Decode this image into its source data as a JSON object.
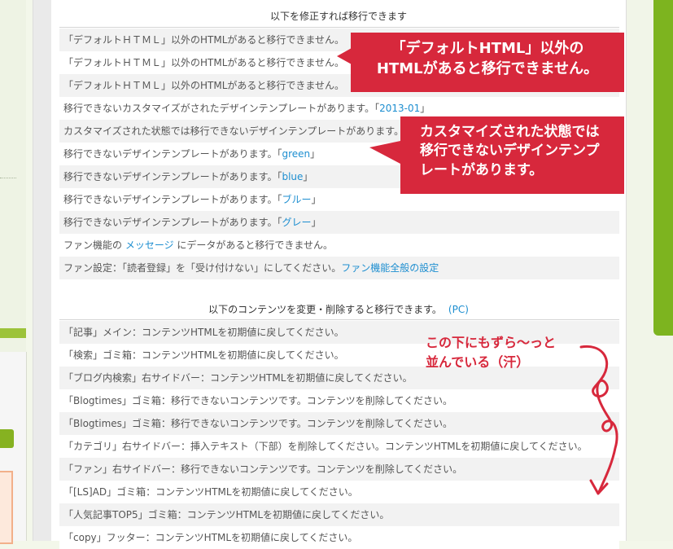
{
  "section1": {
    "title": "以下を修正すれば移行できます",
    "rows": [
      {
        "text": "「デフォルトＨＴＭＬ」以外のHTMLがあると移行できません。",
        "link": "",
        "suffix": ""
      },
      {
        "text": "「デフォルトＨＴＭＬ」以外のHTMLがあると移行できません。",
        "link": "",
        "suffix": ""
      },
      {
        "text": "「デフォルトＨＴＭＬ」以外のHTMLがあると移行できません。",
        "link": "",
        "suffix": ""
      },
      {
        "text": "移行できないカスタマイズがされたデザインテンプレートがあります。「",
        "link": "2013-01",
        "suffix": "」"
      },
      {
        "text": "カスタマイズされた状態では移行できないデザインテンプレートがあります。",
        "link": "",
        "suffix": ""
      },
      {
        "text": "移行できないデザインテンプレートがあります。「",
        "link": "green",
        "suffix": "」"
      },
      {
        "text": "移行できないデザインテンプレートがあります。「",
        "link": "blue",
        "suffix": "」"
      },
      {
        "text": "移行できないデザインテンプレートがあります。「",
        "link": "ブルー",
        "suffix": "」"
      },
      {
        "text": "移行できないデザインテンプレートがあります。「",
        "link": "グレー",
        "suffix": "」"
      },
      {
        "text": "ファン機能の ",
        "link": "メッセージ",
        "suffix": " にデータがあると移行できません。"
      },
      {
        "text": "ファン設定：「読者登録」を「受け付けない」にしてください。",
        "link": "ファン機能全般の設定",
        "suffix": ""
      }
    ]
  },
  "section2": {
    "title": "以下のコンテンツを変更・削除すると移行できます。",
    "pc_link": "(PC)",
    "rows": [
      "「記事」メイン：コンテンツHTMLを初期値に戻してください。",
      "「検索」ゴミ箱：コンテンツHTMLを初期値に戻してください。",
      "「ブログ内検索」右サイドバー：コンテンツHTMLを初期値に戻してください。",
      "「Blogtimes」ゴミ箱：移行できないコンテンツです。コンテンツを削除してください。",
      "「Blogtimes」ゴミ箱：移行できないコンテンツです。コンテンツを削除してください。",
      "「カテゴリ」右サイドバー：挿入テキスト（下部）を削除してください。コンテンツHTMLを初期値に戻してください。",
      "「ファン」右サイドバー：移行できないコンテンツです。コンテンツを削除してください。",
      "「[LS]AD」ゴミ箱：コンテンツHTMLを初期値に戻してください。",
      "「人気記事TOP5」ゴミ箱：コンテンツHTMLを初期値に戻してください。",
      "「copy」フッター：コンテンツHTMLを初期値に戻してください。"
    ]
  },
  "annotations": {
    "callout1": [
      "「デフォルトHTML」以外の",
      "HTMLがあると移行できません。"
    ],
    "callout2": [
      "カスタマイズされた状態では",
      "移行できないデザインテンプ",
      "レートがあります。"
    ],
    "note": [
      "この下にもずら～っと",
      "並んでいる（汗）"
    ]
  },
  "colors": {
    "accent_red": "#d7283c",
    "link_blue": "#1d8ed0",
    "sidebar_green": "#7db41f"
  }
}
